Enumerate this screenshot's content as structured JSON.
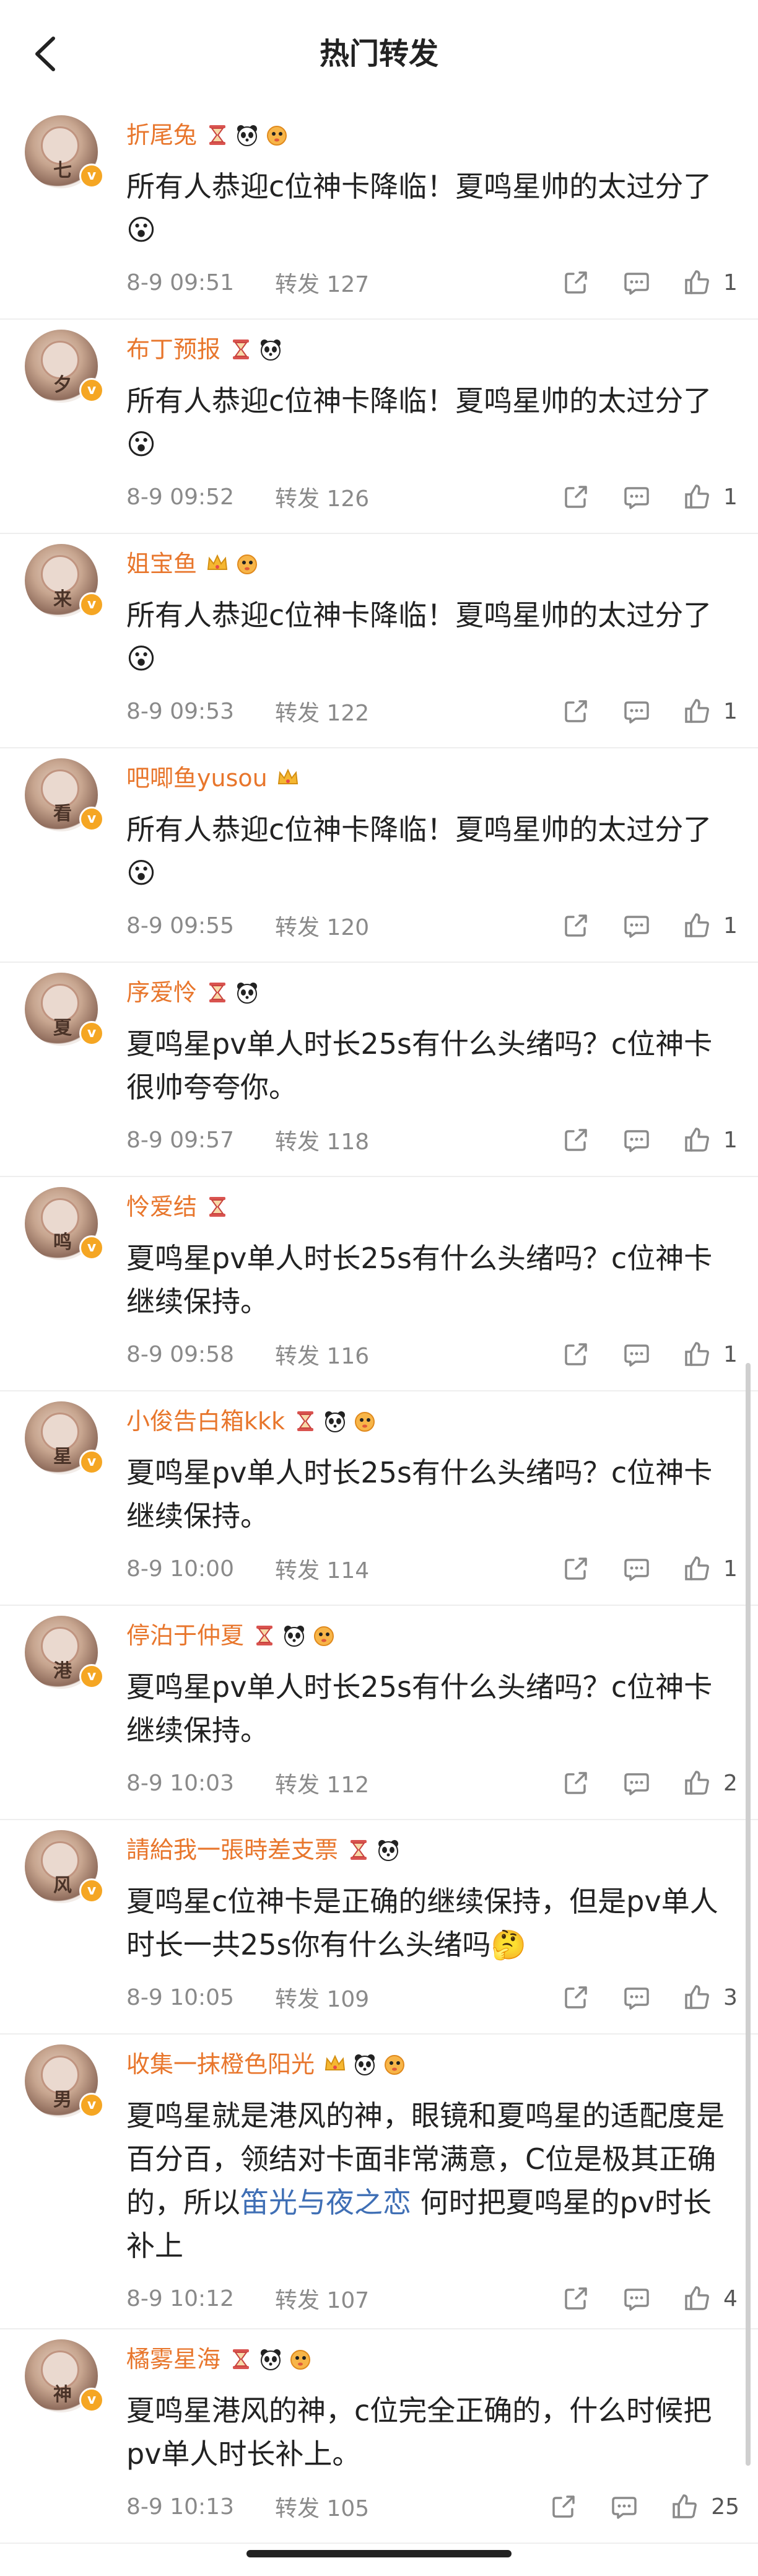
{
  "header": {
    "title": "热门转发"
  },
  "colors": {
    "name": "#e8762c",
    "link": "#3f6fb5",
    "meta": "#8a8a8a"
  },
  "items": [
    {
      "avatar_char": "七",
      "name": "折尾兔",
      "badges": [
        "hourglass-badge",
        "panda-badge",
        "pufferfish-badge"
      ],
      "text": "所有人恭迎c位神卡降临！夏鸣星帅的太过分了😮",
      "link": "",
      "text_after": "",
      "time": "8-9 09:51",
      "forward": "转发 127",
      "likes": "1"
    },
    {
      "avatar_char": "夕",
      "name": "布丁预报",
      "badges": [
        "hourglass-badge",
        "panda-badge"
      ],
      "text": "所有人恭迎c位神卡降临！夏鸣星帅的太过分了😮",
      "link": "",
      "text_after": "",
      "time": "8-9 09:52",
      "forward": "转发 126",
      "likes": "1"
    },
    {
      "avatar_char": "来",
      "name": "姐宝鱼",
      "badges": [
        "crown-badge",
        "pufferfish-badge"
      ],
      "text": "所有人恭迎c位神卡降临！夏鸣星帅的太过分了😮",
      "link": "",
      "text_after": "",
      "time": "8-9 09:53",
      "forward": "转发 122",
      "likes": "1"
    },
    {
      "avatar_char": "看",
      "name": "吧唧鱼yusou",
      "badges": [
        "crown-badge"
      ],
      "text": "所有人恭迎c位神卡降临！夏鸣星帅的太过分了😮",
      "link": "",
      "text_after": "",
      "time": "8-9 09:55",
      "forward": "转发 120",
      "likes": "1"
    },
    {
      "avatar_char": "夏",
      "name": "序爱怜",
      "badges": [
        "hourglass-badge",
        "panda-badge"
      ],
      "text": "夏鸣星pv单人时长25s有什么头绪吗？c位神卡很帅夸夸你。",
      "link": "",
      "text_after": "",
      "time": "8-9 09:57",
      "forward": "转发 118",
      "likes": "1"
    },
    {
      "avatar_char": "鸣",
      "name": "怜爱结",
      "badges": [
        "hourglass-badge"
      ],
      "text": "夏鸣星pv单人时长25s有什么头绪吗？c位神卡继续保持。",
      "link": "",
      "text_after": "",
      "time": "8-9 09:58",
      "forward": "转发 116",
      "likes": "1"
    },
    {
      "avatar_char": "星",
      "name": "小俊告白箱kkk",
      "badges": [
        "hourglass-badge",
        "panda-badge",
        "pufferfish-badge"
      ],
      "text": "夏鸣星pv单人时长25s有什么头绪吗？c位神卡继续保持。",
      "link": "",
      "text_after": "",
      "time": "8-9 10:00",
      "forward": "转发 114",
      "likes": "1"
    },
    {
      "avatar_char": "港",
      "name": "停泊于仲夏",
      "badges": [
        "hourglass-badge",
        "panda-badge",
        "pufferfish-badge"
      ],
      "text": "夏鸣星pv单人时长25s有什么头绪吗？c位神卡继续保持。",
      "link": "",
      "text_after": "",
      "time": "8-9 10:03",
      "forward": "转发 112",
      "likes": "2"
    },
    {
      "avatar_char": "风",
      "name": "請給我一張時差支票",
      "badges": [
        "hourglass-badge",
        "panda-badge"
      ],
      "text": "夏鸣星c位神卡是正确的继续保持，但是pv单人时长一共25s你有什么头绪吗🤔",
      "link": "",
      "text_after": "",
      "time": "8-9 10:05",
      "forward": "转发 109",
      "likes": "3"
    },
    {
      "avatar_char": "男",
      "name": "收集一抹橙色阳光",
      "badges": [
        "crown-badge",
        "panda-badge",
        "pufferfish-badge"
      ],
      "text": "夏鸣星就是港风的神，眼镜和夏鸣星的适配度是百分百，领结对卡面非常满意，C位是极其正确的，所以",
      "link": "笛光与夜之恋",
      "text_after": " 何时把夏鸣星的pv时长补上",
      "time": "8-9 10:12",
      "forward": "转发 107",
      "likes": "4"
    },
    {
      "avatar_char": "神",
      "name": "橘雾星海",
      "badges": [
        "hourglass-badge",
        "panda-badge",
        "pufferfish-badge"
      ],
      "text": "夏鸣星港风的神，c位完全正确的，什么时候把pv单人时长补上。",
      "link": "",
      "text_after": "",
      "time": "8-9 10:13",
      "forward": "转发 105",
      "likes": "25"
    }
  ]
}
